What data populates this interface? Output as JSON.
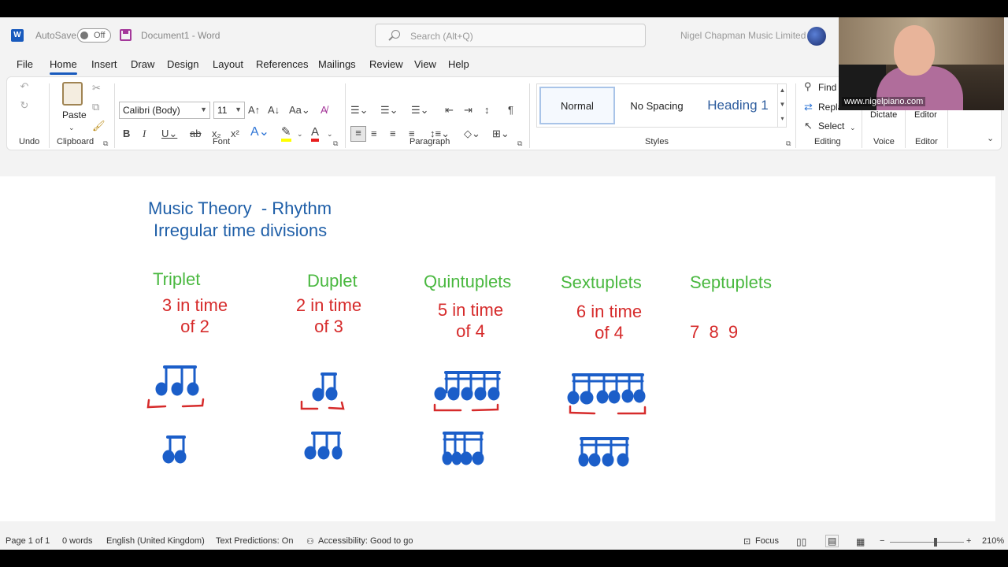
{
  "titlebar": {
    "autosave_label": "AutoSave",
    "autosave_state": "Off",
    "doc_name": "Document1  -  Word",
    "search_placeholder": "Search (Alt+Q)",
    "user_name": "Nigel Chapman Music Limited"
  },
  "menu": {
    "tabs": [
      "File",
      "Home",
      "Insert",
      "Draw",
      "Design",
      "Layout",
      "References",
      "Mailings",
      "Review",
      "View",
      "Help"
    ],
    "active": "Home"
  },
  "ribbon": {
    "groups": {
      "undo": "Undo",
      "clipboard": "Clipboard",
      "font": "Font",
      "paragraph": "Paragraph",
      "styles": "Styles",
      "editing": "Editing",
      "voice": "Voice",
      "editor": "Editor"
    },
    "paste_label": "Paste",
    "font_name": "Calibri (Body)",
    "font_size": "11",
    "styles": [
      "Normal",
      "No Spacing",
      "Heading 1"
    ],
    "editing": {
      "find": "Find",
      "replace": "Repla",
      "select": "Select"
    },
    "voice_button": "Dictate",
    "editor_button": "Editor",
    "colors": {
      "highlight": "#ffff00",
      "font_color": "#e81e1e",
      "accent": "#185abd"
    }
  },
  "document": {
    "title_line1": "Music Theory  - Rhythm",
    "title_line2": "Irregular time divisions",
    "columns": [
      {
        "heading": "Triplet",
        "desc_line1": "3 in time",
        "desc_line2": "of 2"
      },
      {
        "heading": "Duplet",
        "desc_line1": "2 in time",
        "desc_line2": "of  3"
      },
      {
        "heading": "Quintuplets",
        "desc_line1": "5 in time",
        "desc_line2": "of 4"
      },
      {
        "heading": "Sextuplets",
        "desc_line1": "6 in time",
        "desc_line2": "of 4"
      },
      {
        "heading": "Septuplets",
        "desc_line1": "7  8  9",
        "desc_line2": ""
      }
    ]
  },
  "status": {
    "page": "Page 1 of 1",
    "words": "0 words",
    "language": "English (United Kingdom)",
    "predictions": "Text Predictions: On",
    "accessibility": "Accessibility: Good to go",
    "focus": "Focus",
    "zoom": "210%"
  },
  "webcam": {
    "caption": "www.nigelpiano.com"
  }
}
